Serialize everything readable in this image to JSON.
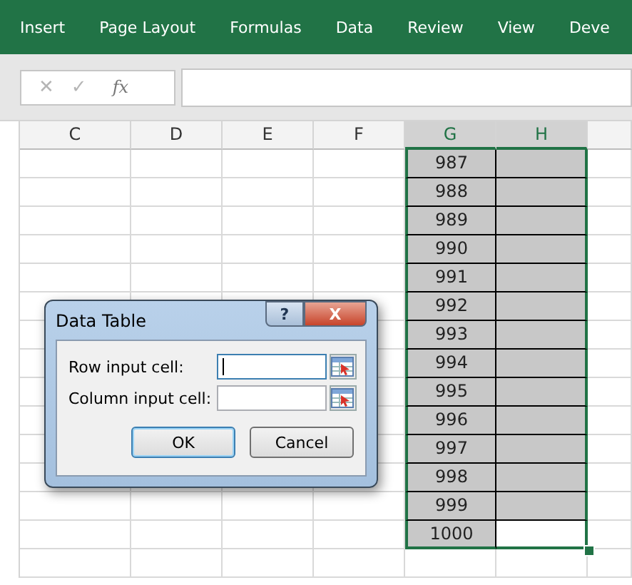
{
  "ribbon_tabs": [
    {
      "label": "Insert"
    },
    {
      "label": "Page Layout"
    },
    {
      "label": "Formulas"
    },
    {
      "label": "Data"
    },
    {
      "label": "Review"
    },
    {
      "label": "View"
    },
    {
      "label": "Deve"
    }
  ],
  "formula_bar": {
    "cancel": "✕",
    "enter": "✓",
    "function": "fx"
  },
  "columns": [
    {
      "label": "C",
      "selected": false
    },
    {
      "label": "D",
      "selected": false
    },
    {
      "label": "E",
      "selected": false
    },
    {
      "label": "F",
      "selected": false
    },
    {
      "label": "G",
      "selected": true
    },
    {
      "label": "H",
      "selected": true
    }
  ],
  "rows": [
    {
      "g": "987",
      "h_active": false
    },
    {
      "g": "988",
      "h_active": false
    },
    {
      "g": "989",
      "h_active": false
    },
    {
      "g": "990",
      "h_active": false
    },
    {
      "g": "991",
      "h_active": false
    },
    {
      "g": "992",
      "h_active": false
    },
    {
      "g": "993",
      "h_active": false
    },
    {
      "g": "994",
      "h_active": false
    },
    {
      "g": "995",
      "h_active": false
    },
    {
      "g": "996",
      "h_active": false
    },
    {
      "g": "997",
      "h_active": false
    },
    {
      "g": "998",
      "h_active": false
    },
    {
      "g": "999",
      "h_active": false
    },
    {
      "g": "1000",
      "h_active": true
    }
  ],
  "dialog": {
    "title": "Data Table",
    "help": "?",
    "close": "X",
    "fields": [
      {
        "label": "Row input cell:",
        "focused": true
      },
      {
        "label": "Column input cell:",
        "focused": false
      }
    ],
    "buttons": [
      {
        "label": "OK",
        "default": true
      },
      {
        "label": "Cancel",
        "default": false
      }
    ]
  }
}
